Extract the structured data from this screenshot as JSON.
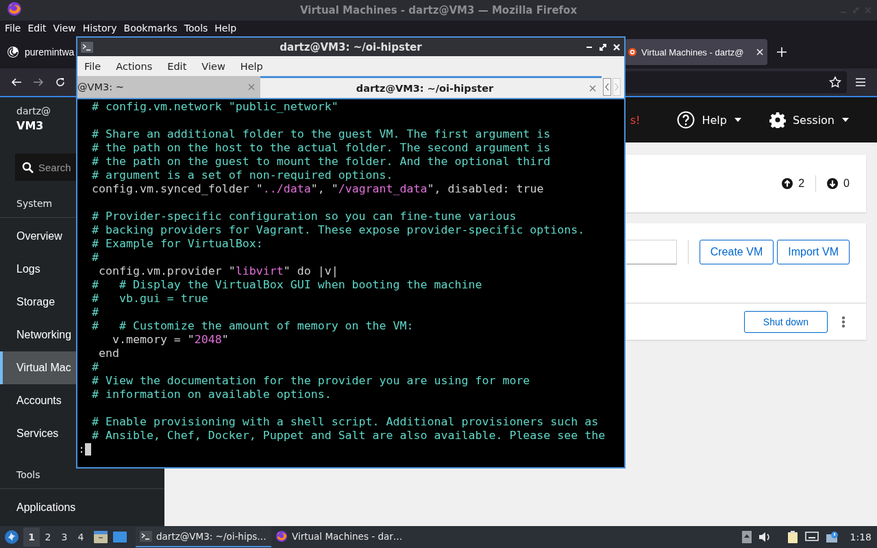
{
  "firefox": {
    "title": "Virtual Machines - dartz@VM3 — Mozilla Firefox",
    "menu": [
      "File",
      "Edit",
      "View",
      "History",
      "Bookmarks",
      "Tools",
      "Help"
    ],
    "tabs": [
      {
        "label": "puremintwa",
        "selected": false
      },
      {
        "label": "Virtual Machines - dartz@",
        "selected": true
      }
    ],
    "page": {
      "host": {
        "user": "dartz@",
        "name": "VM3"
      },
      "search": {
        "placeholder": "Search"
      },
      "sections": [
        {
          "label": "System",
          "items": [
            {
              "label": "Overview",
              "selected": false
            },
            {
              "label": "Logs",
              "selected": false
            },
            {
              "label": "Storage",
              "selected": false
            },
            {
              "label": "Networking",
              "selected": false
            },
            {
              "label": "Virtual Mac",
              "selected": true
            },
            {
              "label": "Accounts",
              "selected": false
            },
            {
              "label": "Services",
              "selected": false
            }
          ]
        },
        {
          "label": "Tools",
          "items": [
            {
              "label": "Applications",
              "selected": false
            }
          ]
        }
      ],
      "header": {
        "alert": "s!",
        "help": "Help",
        "session": "Session"
      },
      "summary": {
        "up": "2",
        "down": "0"
      },
      "toolbar": {
        "buttons": [
          "Create VM",
          "Import VM"
        ]
      },
      "row": {
        "action": "Shut down"
      }
    }
  },
  "terminal": {
    "title": "dartz@VM3: ~/oi-hipster",
    "menu": [
      "File",
      "Actions",
      "Edit",
      "View",
      "Help"
    ],
    "tabs": [
      {
        "label": "@VM3: ~",
        "selected": false
      },
      {
        "label": "dartz@VM3: ~/oi-hipster",
        "selected": true
      }
    ],
    "lines": [
      {
        "kind": "text",
        "segments": [
          {
            "kind": "comment",
            "text": "  # config.vm.network \"public_network\""
          }
        ]
      },
      {
        "kind": "blank"
      },
      {
        "kind": "text",
        "segments": [
          {
            "kind": "comment",
            "text": "  # Share an additional folder to the guest VM. The first argument is"
          }
        ]
      },
      {
        "kind": "text",
        "segments": [
          {
            "kind": "comment",
            "text": "  # the path on the host to the actual folder. The second argument is"
          }
        ]
      },
      {
        "kind": "text",
        "segments": [
          {
            "kind": "comment",
            "text": "  # the path on the guest to mount the folder. And the optional third"
          }
        ]
      },
      {
        "kind": "text",
        "segments": [
          {
            "kind": "comment",
            "text": "  # argument is a set of non-required options."
          }
        ]
      },
      {
        "kind": "text",
        "segments": [
          {
            "kind": "code",
            "text": "  config.vm.synced_folder \""
          },
          {
            "kind": "string",
            "text": "../data"
          },
          {
            "kind": "code",
            "text": "\", \""
          },
          {
            "kind": "string",
            "text": "/vagrant_data"
          },
          {
            "kind": "code",
            "text": "\", disabled: true"
          }
        ]
      },
      {
        "kind": "blank"
      },
      {
        "kind": "text",
        "segments": [
          {
            "kind": "comment",
            "text": "  # Provider-specific configuration so you can fine-tune various"
          }
        ]
      },
      {
        "kind": "text",
        "segments": [
          {
            "kind": "comment",
            "text": "  # backing providers for Vagrant. These expose provider-specific options."
          }
        ]
      },
      {
        "kind": "text",
        "segments": [
          {
            "kind": "comment",
            "text": "  # Example for VirtualBox:"
          }
        ]
      },
      {
        "kind": "text",
        "segments": [
          {
            "kind": "comment",
            "text": "  #"
          }
        ]
      },
      {
        "kind": "text",
        "segments": [
          {
            "kind": "code",
            "text": "   config.vm.provider \""
          },
          {
            "kind": "string",
            "text": "libvirt"
          },
          {
            "kind": "code",
            "text": "\" do |v|"
          }
        ]
      },
      {
        "kind": "text",
        "segments": [
          {
            "kind": "comment",
            "text": "  #   # Display the VirtualBox GUI when booting the machine"
          }
        ]
      },
      {
        "kind": "text",
        "segments": [
          {
            "kind": "comment",
            "text": "  #   vb.gui = true"
          }
        ]
      },
      {
        "kind": "text",
        "segments": [
          {
            "kind": "comment",
            "text": "  #"
          }
        ]
      },
      {
        "kind": "text",
        "segments": [
          {
            "kind": "comment",
            "text": "  #   # Customize the amount of memory on the VM:"
          }
        ]
      },
      {
        "kind": "text",
        "segments": [
          {
            "kind": "code",
            "text": "     v.memory = \""
          },
          {
            "kind": "string",
            "text": "2048"
          },
          {
            "kind": "code",
            "text": "\""
          }
        ]
      },
      {
        "kind": "text",
        "segments": [
          {
            "kind": "code",
            "text": "   end"
          }
        ]
      },
      {
        "kind": "text",
        "segments": [
          {
            "kind": "comment",
            "text": "  #"
          }
        ]
      },
      {
        "kind": "text",
        "segments": [
          {
            "kind": "comment",
            "text": "  # View the documentation for the provider you are using for more"
          }
        ]
      },
      {
        "kind": "text",
        "segments": [
          {
            "kind": "comment",
            "text": "  # information on available options."
          }
        ]
      },
      {
        "kind": "blank"
      },
      {
        "kind": "text",
        "segments": [
          {
            "kind": "comment",
            "text": "  # Enable provisioning with a shell script. Additional provisioners such as"
          }
        ]
      },
      {
        "kind": "text",
        "segments": [
          {
            "kind": "comment",
            "text": "  # Ansible, Chef, Docker, Puppet and Salt are also available. Please see the"
          }
        ]
      }
    ],
    "prompt": ":"
  },
  "taskbar": {
    "workspaces": [
      {
        "label": "1",
        "selected": true
      },
      {
        "label": "2",
        "selected": false
      },
      {
        "label": "3",
        "selected": false
      },
      {
        "label": "4",
        "selected": false
      }
    ],
    "tasks": [
      {
        "kind": "terminal",
        "label": "dartz@VM3: ~/oi-hips…",
        "selected": true
      },
      {
        "kind": "browser",
        "label": "Virtual Machines - dar…",
        "selected": false
      }
    ],
    "clock": "1:18"
  }
}
